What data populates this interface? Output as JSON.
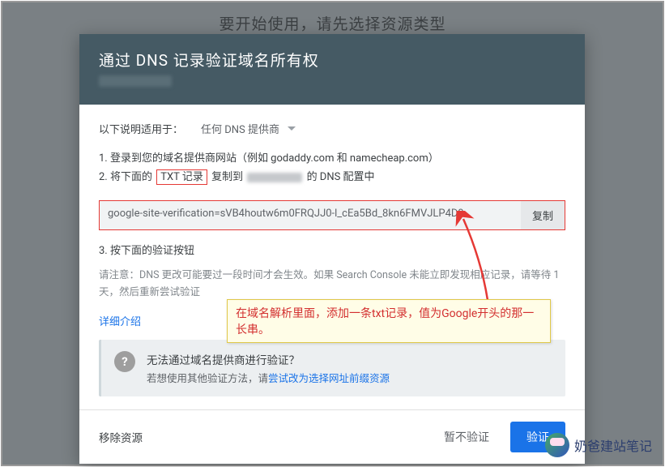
{
  "backdrop": {
    "heading": "要开始使用，请先选择资源类型"
  },
  "dialog": {
    "title": "通过 DNS 记录验证域名所有权",
    "provider_label": "以下说明适用于：",
    "provider_value": "任何 DNS 提供商",
    "step1": "1. 登录到您的域名提供商网站（例如 godaddy.com 和 namecheap.com）",
    "step2_prefix": "2. 将下面的",
    "step2_highlight": "TXT 记录",
    "step2_mid": "复制到",
    "step2_suffix": "的 DNS 配置中",
    "txt_value": "google-site-verification=sVB4houtw6m0FRQJJ0-l_cEa5Bd_8kn6FMVJLP4D9",
    "copy_label": "复制",
    "step3": "3. 按下面的验证按钮",
    "note": "请注意：DNS 更改可能要过一段时间才会生效。如果 Search Console 未能立即发现相应记录，请等待 1 天，然后重新尝试验证",
    "detail_link": "详细介绍",
    "warn_title": "无法通过域名提供商进行验证？",
    "warn_sub_prefix": "若想使用其他验证方法，请",
    "warn_link": "尝试改为选择网址前缀资源",
    "footer": {
      "remove": "移除资源",
      "skip": "暂不验证",
      "verify": "验证"
    }
  },
  "annotation": {
    "text": "在域名解析里面，添加一条txt记录，值为Google开头的那一长串。"
  },
  "watermark": {
    "text": "奶爸建站笔记"
  }
}
